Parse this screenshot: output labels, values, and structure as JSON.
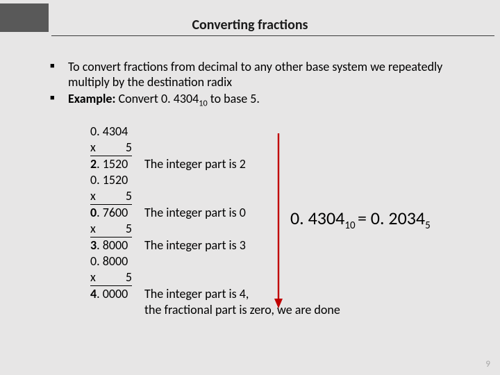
{
  "title": "Converting fractions",
  "bullets": {
    "b1": "To convert fractions from decimal to any other base system we repeatedly multiply by the destination radix",
    "b2_label": "Example:",
    "b2_text1": " Convert 0. 4304",
    "b2_sub": "10",
    "b2_text2": " to base 5."
  },
  "work": {
    "r01_a": "0. 4304",
    "r02_x": "x",
    "r02_n": "5",
    "r03_a": "2",
    "r03_rest": ". 1520",
    "r03_note": "The integer part is 2",
    "r04_a": "0. 1520",
    "r05_x": "x",
    "r05_n": "5",
    "r06_a": "0",
    "r06_rest": ". 7600",
    "r06_note": "The integer part is 0",
    "r07_x": "x",
    "r07_n": "5",
    "r08_a": "3",
    "r08_rest": ". 8000",
    "r08_note": "The integer part is 3",
    "r09_a": "0. 8000",
    "r10_x": "x",
    "r10_n": "5",
    "r11_a": "4",
    "r11_rest": ". 0000",
    "r11_note1": "The integer part is 4,",
    "r11_note2": "the fractional part is zero, we are done"
  },
  "result": {
    "lhs": "0. 4304",
    "lsub": "10 ",
    "eq": "= 0. 2034",
    "rsub": "5"
  },
  "pagenum": "9"
}
